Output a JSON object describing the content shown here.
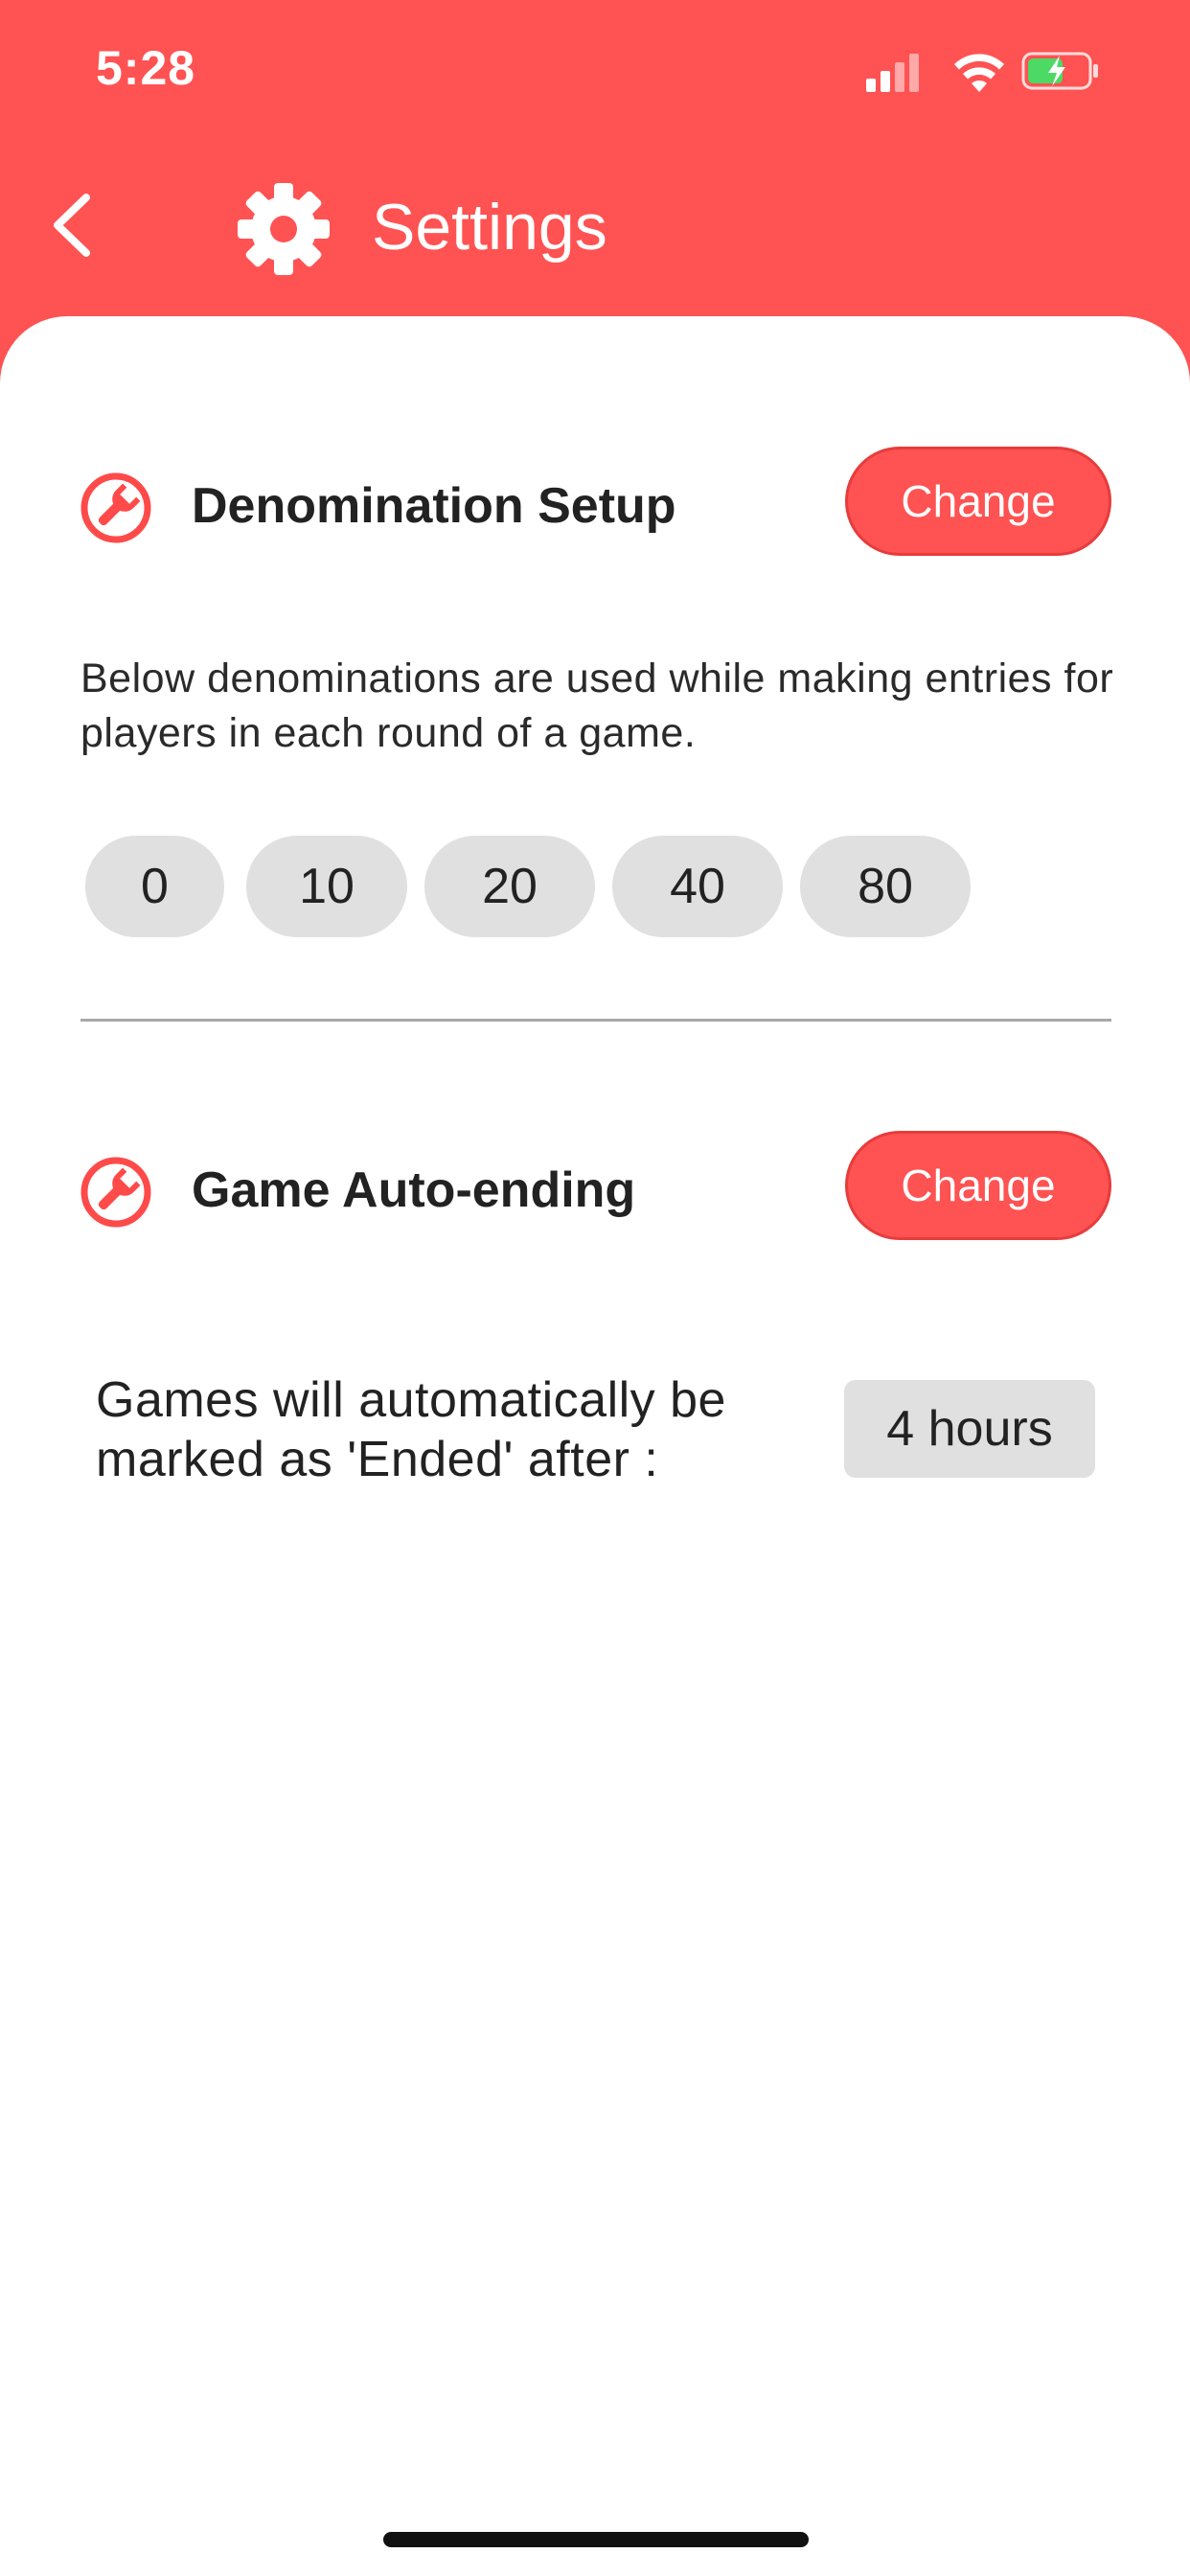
{
  "status_bar": {
    "time": "5:28"
  },
  "header": {
    "title": "Settings",
    "back_icon": "chevron-left-icon",
    "title_icon": "gear-icon"
  },
  "denomination_section": {
    "title": "Denomination Setup",
    "icon": "wrench-icon",
    "change_label": "Change",
    "description": "Below denominations are used while making entries for players in each round of a game.",
    "denominations": [
      "0",
      "10",
      "20",
      "40",
      "80"
    ]
  },
  "auto_end_section": {
    "title": "Game Auto-ending",
    "icon": "wrench-icon",
    "change_label": "Change",
    "description": "Games will automatically be marked as 'Ended' after :",
    "duration": "4 hours"
  },
  "colors": {
    "accent": "#ff5252",
    "chip_bg": "#e0e0e0",
    "text": "#222222"
  }
}
